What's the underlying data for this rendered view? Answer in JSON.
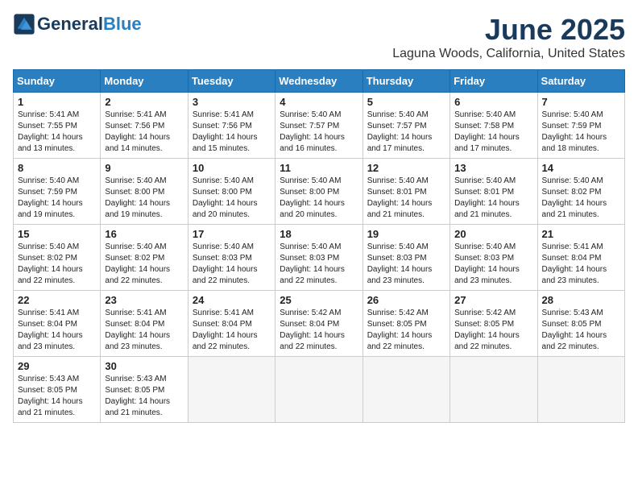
{
  "header": {
    "logo_general": "General",
    "logo_blue": "Blue",
    "title": "June 2025",
    "subtitle": "Laguna Woods, California, United States"
  },
  "days_of_week": [
    "Sunday",
    "Monday",
    "Tuesday",
    "Wednesday",
    "Thursday",
    "Friday",
    "Saturday"
  ],
  "weeks": [
    [
      {
        "day": "1",
        "info": "Sunrise: 5:41 AM\nSunset: 7:55 PM\nDaylight: 14 hours\nand 13 minutes."
      },
      {
        "day": "2",
        "info": "Sunrise: 5:41 AM\nSunset: 7:56 PM\nDaylight: 14 hours\nand 14 minutes."
      },
      {
        "day": "3",
        "info": "Sunrise: 5:41 AM\nSunset: 7:56 PM\nDaylight: 14 hours\nand 15 minutes."
      },
      {
        "day": "4",
        "info": "Sunrise: 5:40 AM\nSunset: 7:57 PM\nDaylight: 14 hours\nand 16 minutes."
      },
      {
        "day": "5",
        "info": "Sunrise: 5:40 AM\nSunset: 7:57 PM\nDaylight: 14 hours\nand 17 minutes."
      },
      {
        "day": "6",
        "info": "Sunrise: 5:40 AM\nSunset: 7:58 PM\nDaylight: 14 hours\nand 17 minutes."
      },
      {
        "day": "7",
        "info": "Sunrise: 5:40 AM\nSunset: 7:59 PM\nDaylight: 14 hours\nand 18 minutes."
      }
    ],
    [
      {
        "day": "8",
        "info": "Sunrise: 5:40 AM\nSunset: 7:59 PM\nDaylight: 14 hours\nand 19 minutes."
      },
      {
        "day": "9",
        "info": "Sunrise: 5:40 AM\nSunset: 8:00 PM\nDaylight: 14 hours\nand 19 minutes."
      },
      {
        "day": "10",
        "info": "Sunrise: 5:40 AM\nSunset: 8:00 PM\nDaylight: 14 hours\nand 20 minutes."
      },
      {
        "day": "11",
        "info": "Sunrise: 5:40 AM\nSunset: 8:00 PM\nDaylight: 14 hours\nand 20 minutes."
      },
      {
        "day": "12",
        "info": "Sunrise: 5:40 AM\nSunset: 8:01 PM\nDaylight: 14 hours\nand 21 minutes."
      },
      {
        "day": "13",
        "info": "Sunrise: 5:40 AM\nSunset: 8:01 PM\nDaylight: 14 hours\nand 21 minutes."
      },
      {
        "day": "14",
        "info": "Sunrise: 5:40 AM\nSunset: 8:02 PM\nDaylight: 14 hours\nand 21 minutes."
      }
    ],
    [
      {
        "day": "15",
        "info": "Sunrise: 5:40 AM\nSunset: 8:02 PM\nDaylight: 14 hours\nand 22 minutes."
      },
      {
        "day": "16",
        "info": "Sunrise: 5:40 AM\nSunset: 8:02 PM\nDaylight: 14 hours\nand 22 minutes."
      },
      {
        "day": "17",
        "info": "Sunrise: 5:40 AM\nSunset: 8:03 PM\nDaylight: 14 hours\nand 22 minutes."
      },
      {
        "day": "18",
        "info": "Sunrise: 5:40 AM\nSunset: 8:03 PM\nDaylight: 14 hours\nand 22 minutes."
      },
      {
        "day": "19",
        "info": "Sunrise: 5:40 AM\nSunset: 8:03 PM\nDaylight: 14 hours\nand 23 minutes."
      },
      {
        "day": "20",
        "info": "Sunrise: 5:40 AM\nSunset: 8:03 PM\nDaylight: 14 hours\nand 23 minutes."
      },
      {
        "day": "21",
        "info": "Sunrise: 5:41 AM\nSunset: 8:04 PM\nDaylight: 14 hours\nand 23 minutes."
      }
    ],
    [
      {
        "day": "22",
        "info": "Sunrise: 5:41 AM\nSunset: 8:04 PM\nDaylight: 14 hours\nand 23 minutes."
      },
      {
        "day": "23",
        "info": "Sunrise: 5:41 AM\nSunset: 8:04 PM\nDaylight: 14 hours\nand 23 minutes."
      },
      {
        "day": "24",
        "info": "Sunrise: 5:41 AM\nSunset: 8:04 PM\nDaylight: 14 hours\nand 22 minutes."
      },
      {
        "day": "25",
        "info": "Sunrise: 5:42 AM\nSunset: 8:04 PM\nDaylight: 14 hours\nand 22 minutes."
      },
      {
        "day": "26",
        "info": "Sunrise: 5:42 AM\nSunset: 8:05 PM\nDaylight: 14 hours\nand 22 minutes."
      },
      {
        "day": "27",
        "info": "Sunrise: 5:42 AM\nSunset: 8:05 PM\nDaylight: 14 hours\nand 22 minutes."
      },
      {
        "day": "28",
        "info": "Sunrise: 5:43 AM\nSunset: 8:05 PM\nDaylight: 14 hours\nand 22 minutes."
      }
    ],
    [
      {
        "day": "29",
        "info": "Sunrise: 5:43 AM\nSunset: 8:05 PM\nDaylight: 14 hours\nand 21 minutes."
      },
      {
        "day": "30",
        "info": "Sunrise: 5:43 AM\nSunset: 8:05 PM\nDaylight: 14 hours\nand 21 minutes."
      },
      {
        "day": "",
        "info": ""
      },
      {
        "day": "",
        "info": ""
      },
      {
        "day": "",
        "info": ""
      },
      {
        "day": "",
        "info": ""
      },
      {
        "day": "",
        "info": ""
      }
    ]
  ]
}
